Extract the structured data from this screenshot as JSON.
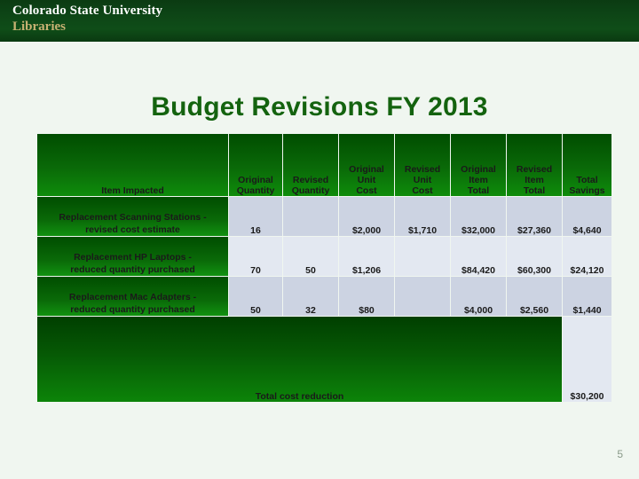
{
  "banner": {
    "org_line1": "Colorado State University",
    "org_line2": "Libraries",
    "brand_green": "#0d4516",
    "brand_gold": "#c8b273"
  },
  "slide": {
    "title": "Budget Revisions FY  2013",
    "title_color": "#14630f",
    "background_color": "#f0f6f0",
    "page_number": "5"
  },
  "table": {
    "headers": [
      "Item Impacted",
      "Original Quantity",
      "Revised Quantity",
      "Original Unit Cost",
      "Revised Unit Cost",
      "Original Item Total",
      "Revised Item Total",
      "Total Savings"
    ],
    "headers_split": [
      {
        "l1": "Item Impacted",
        "l2": "",
        "l3": ""
      },
      {
        "l1": "Original",
        "l2": "Quantity",
        "l3": ""
      },
      {
        "l1": "Revised",
        "l2": "Quantity",
        "l3": ""
      },
      {
        "l1": "Original",
        "l2": "Unit",
        "l3": "Cost"
      },
      {
        "l1": "Revised",
        "l2": "Unit",
        "l3": "Cost"
      },
      {
        "l1": "Original",
        "l2": "Item",
        "l3": "Total"
      },
      {
        "l1": "Revised",
        "l2": "Item",
        "l3": "Total"
      },
      {
        "l1": "Total",
        "l2": "Savings",
        "l3": ""
      }
    ],
    "rows": [
      {
        "item_l1": "Replacement Scanning Stations -",
        "item_l2": "revised cost estimate",
        "original_quantity": "16",
        "revised_quantity": "",
        "original_unit_cost": "$2,000",
        "revised_unit_cost": "$1,710",
        "original_item_total": "$32,000",
        "revised_item_total": "$27,360",
        "total_savings": "$4,640"
      },
      {
        "item_l1": "Replacement HP Laptops -",
        "item_l2": "reduced quantity purchased",
        "original_quantity": "70",
        "revised_quantity": "50",
        "original_unit_cost": "$1,206",
        "revised_unit_cost": "",
        "original_item_total": "$84,420",
        "revised_item_total": "$60,300",
        "total_savings": "$24,120"
      },
      {
        "item_l1": "Replacement Mac Adapters -",
        "item_l2": "reduced quantity purchased",
        "original_quantity": "50",
        "revised_quantity": "32",
        "original_unit_cost": "$80",
        "revised_unit_cost": "",
        "original_item_total": "$4,000",
        "revised_item_total": "$2,560",
        "total_savings": "$1,440"
      }
    ],
    "total_row": {
      "label": "Total cost reduction",
      "value": "$30,200"
    },
    "header_bg_green": "#0a6a08",
    "row_bg_dark": "#ccd3e2",
    "row_bg_light": "#e3e8f1"
  }
}
